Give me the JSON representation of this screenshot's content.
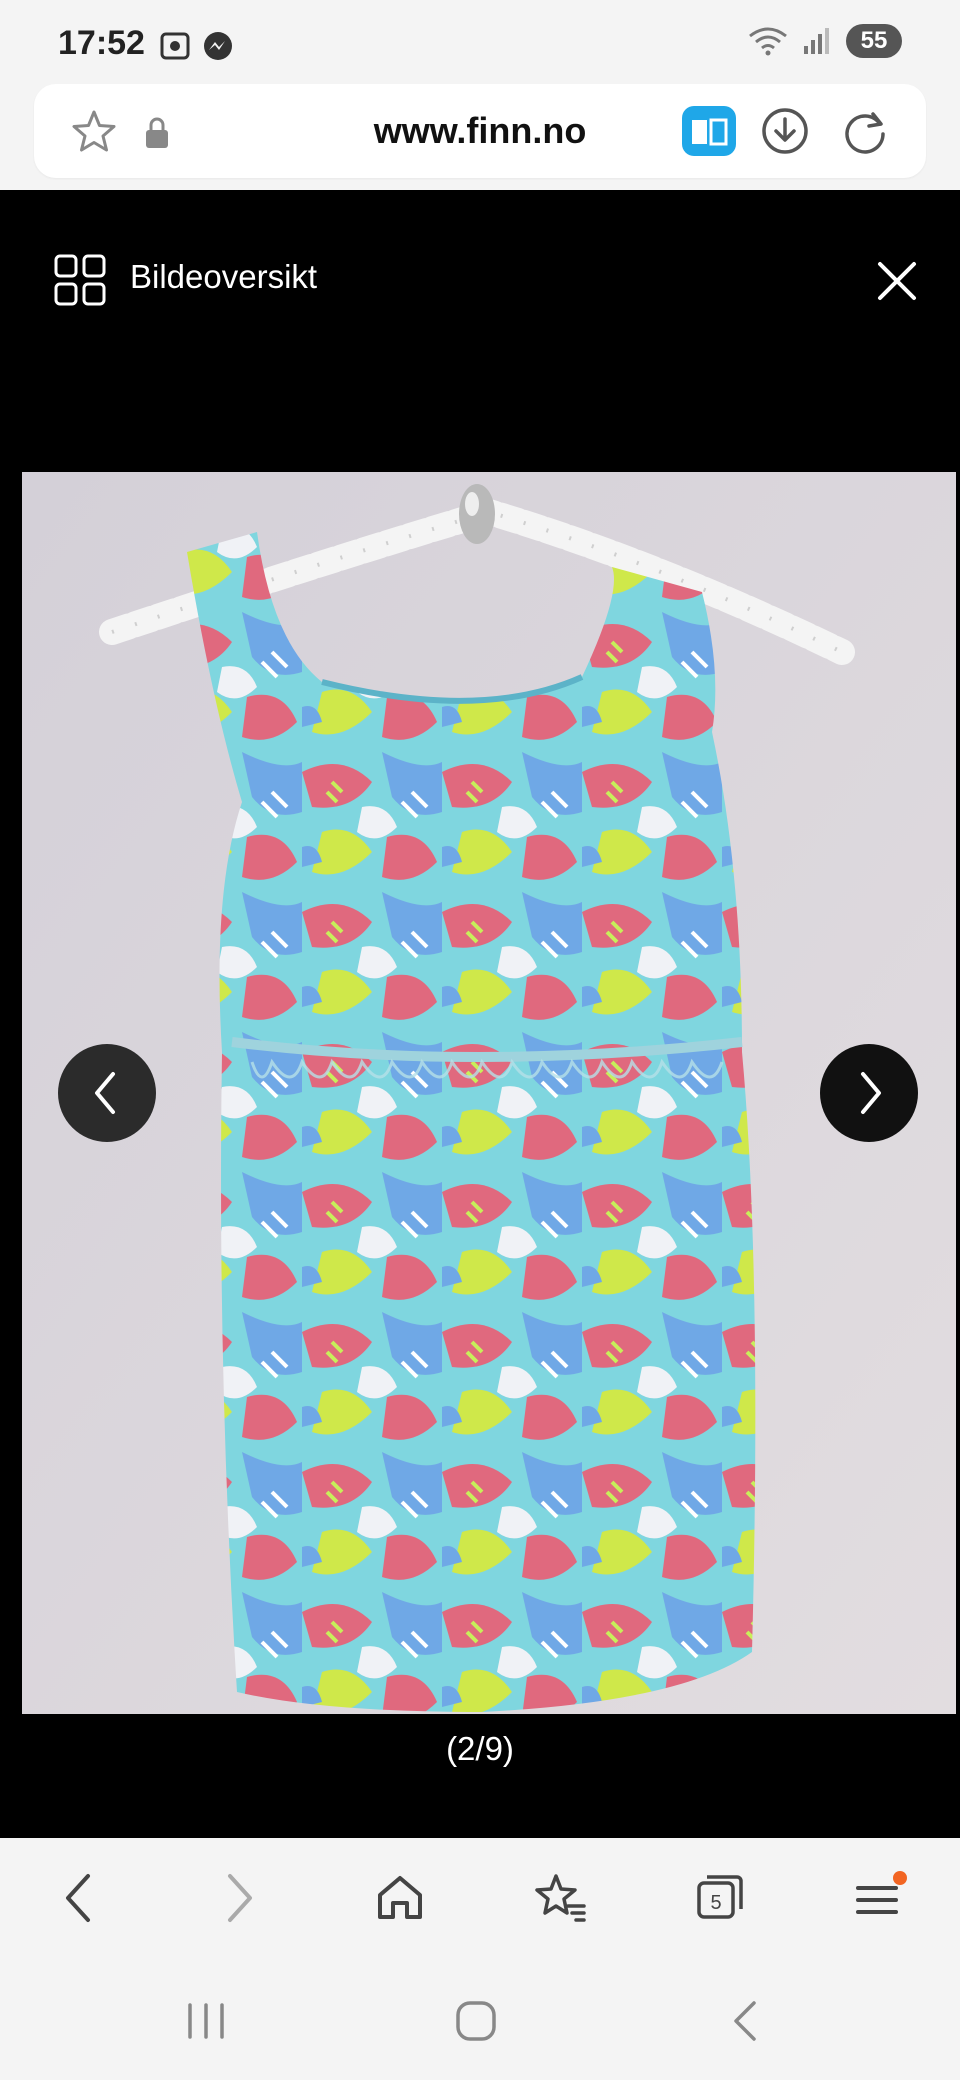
{
  "status": {
    "time": "17:52",
    "battery": "55"
  },
  "browser": {
    "url": "www.finn.no",
    "tab_count": "5"
  },
  "gallery": {
    "overview_label": "Bildeoversikt",
    "counter": "(2/9)",
    "image_alt": "Patterned sleeveless summer dress on a pearl hanger"
  },
  "colors": {
    "accent_blue": "#1fa7e8",
    "notification_dot": "#f26522"
  }
}
